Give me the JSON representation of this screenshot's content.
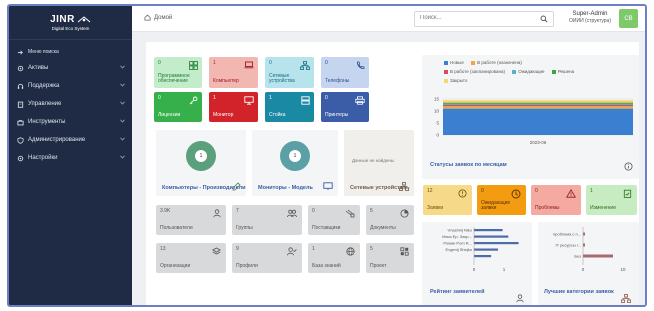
{
  "app": {
    "brand": "JINR",
    "subtitle": "Digital Eco System"
  },
  "sidebar": {
    "items": [
      {
        "label": "Меню поиска",
        "icon": "arrow-icon"
      },
      {
        "label": "Активы",
        "icon": "gear-icon"
      },
      {
        "label": "Поддержка",
        "icon": "headset-icon"
      },
      {
        "label": "Управление",
        "icon": "clipboard-icon"
      },
      {
        "label": "Инструменты",
        "icon": "briefcase-icon"
      },
      {
        "label": "Администрирование",
        "icon": "shield-icon"
      },
      {
        "label": "Настройки",
        "icon": "gear-icon"
      }
    ]
  },
  "topbar": {
    "breadcrumb": "Домой",
    "search_placeholder": "Поиск...",
    "user_name": "Super-Admin",
    "user_role": "ОИИИ (структура)",
    "avatar_initials": "CB"
  },
  "colors": {
    "green": "#35b04a",
    "red": "#d2232a",
    "teal": "#1a89a4",
    "blue": "#3b5ca7",
    "light_green": "#c3ecca",
    "light_red": "#f3b7b2",
    "light_teal": "#b6e3ec",
    "light_blue": "#c6d5ef",
    "orange": "#f39c12",
    "yellow": "#f7d98a",
    "pink": "#f4a9a1",
    "lime": "#c8ecc1"
  },
  "asset_tiles": [
    {
      "count": "0",
      "label": "Программное обеспечение",
      "icon": "code-icon"
    },
    {
      "count": "1",
      "label": "Компьютер",
      "icon": "laptop-icon"
    },
    {
      "count": "0",
      "label": "Сетевые устройства",
      "icon": "network-icon"
    },
    {
      "count": "0",
      "label": "Телефоны",
      "icon": "phone-icon"
    },
    {
      "count": "0",
      "label": "Лицензии",
      "icon": "key-icon"
    },
    {
      "count": "1",
      "label": "Монитор",
      "icon": "monitor-icon"
    },
    {
      "count": "1",
      "label": "Стойка",
      "icon": "server-icon"
    },
    {
      "count": "0",
      "label": "Принтеры",
      "icon": "printer-icon"
    }
  ],
  "wide_tiles": [
    {
      "center": "1",
      "label": "Компьютеры - Производители",
      "icon": "edit-icon"
    },
    {
      "center": "1",
      "label": "Мониторы - Модель",
      "icon": "monitor-icon"
    },
    {
      "center": "",
      "note": "Данные не найдены",
      "label": "Сетевые устройства -",
      "icon": "network-icon"
    }
  ],
  "gray_tiles": [
    {
      "count": "3.9K",
      "label": "Пользователи",
      "icon": "user-icon"
    },
    {
      "count": "7",
      "label": "Группы",
      "icon": "users-icon"
    },
    {
      "count": "0",
      "label": "Поставщики",
      "icon": "truck-icon"
    },
    {
      "count": "5",
      "label": "Документы",
      "icon": "document-icon"
    },
    {
      "count": "13",
      "label": "Организации",
      "icon": "layers-icon"
    },
    {
      "count": "9",
      "label": "Профили",
      "icon": "user-check-icon"
    },
    {
      "count": "1",
      "label": "База знаний",
      "icon": "globe-icon"
    },
    {
      "count": "5",
      "label": "Проект",
      "icon": "project-icon"
    }
  ],
  "status_chart": {
    "title": "Статусы заявок по месяцам",
    "legend": [
      {
        "name": "Новые",
        "color": "#3b7fd0"
      },
      {
        "name": "В работе (назначена)",
        "color": "#f3a73c"
      },
      {
        "name": "В работе (запланирована)",
        "color": "#d9485b"
      },
      {
        "name": "Ожидающие",
        "color": "#5ab0c4"
      },
      {
        "name": "Решена",
        "color": "#3ca34a"
      },
      {
        "name": "Закрыто",
        "color": "#f6d66a"
      }
    ],
    "y_ticks": [
      "15",
      "10",
      "5",
      "0"
    ],
    "x_label": "2023-06"
  },
  "chart_data": [
    {
      "type": "bar",
      "title": "Статусы заявок по месяцам",
      "categories": [
        "2023-06"
      ],
      "ylim": [
        0,
        15
      ],
      "series": [
        {
          "name": "Новые",
          "values": [
            11
          ]
        },
        {
          "name": "В работе (назначена)",
          "values": [
            1
          ]
        },
        {
          "name": "В работе (запланирована)",
          "values": [
            0.5
          ]
        },
        {
          "name": "Ожидающие",
          "values": [
            0.5
          ]
        },
        {
          "name": "Решена",
          "values": [
            0.5
          ]
        },
        {
          "name": "Закрыто",
          "values": [
            1
          ]
        }
      ]
    },
    {
      "type": "bar",
      "title": "Рейтинг заявителей",
      "categories": [
        "Vnashnij Niko",
        "Илья Ер. Захр...",
        "Роман Pom R...",
        "Evgenij Shejko",
        ""
      ],
      "values": [
        2.5,
        3.0,
        3.9,
        2.1,
        1.5
      ],
      "xlim": [
        0,
        1
      ]
    },
    {
      "type": "bar",
      "title": "Лучшие категории заявок",
      "categories": [
        "проблема с п...",
        "IT ресурсы г...",
        "Без"
      ],
      "values": [
        0.5,
        0.5,
        7.5
      ],
      "xticks": [
        "0",
        "10"
      ]
    }
  ],
  "ticket_tiles": [
    {
      "count": "12",
      "label": "Заявки",
      "icon": "alert-circle-icon"
    },
    {
      "count": "0",
      "label": "Ожидающие заявки",
      "icon": "clock-icon"
    },
    {
      "count": "0",
      "label": "Проблемы",
      "icon": "warning-icon"
    },
    {
      "count": "1",
      "label": "Изменение",
      "icon": "clipboard-check-icon"
    }
  ],
  "rating": {
    "title": "Рейтинг заявителей",
    "names": [
      "Vnashnij Niko",
      "Илья Ер. Захр...",
      "Роман Pom R...",
      "Evgenij Shejko"
    ],
    "x_ticks": [
      "0",
      "1"
    ]
  },
  "categories_panel": {
    "title": "Лучшие категории заявок",
    "names": [
      "проблема с п...",
      "IT ресурсы г...",
      "Без"
    ],
    "x_ticks": [
      "0",
      "10"
    ]
  }
}
